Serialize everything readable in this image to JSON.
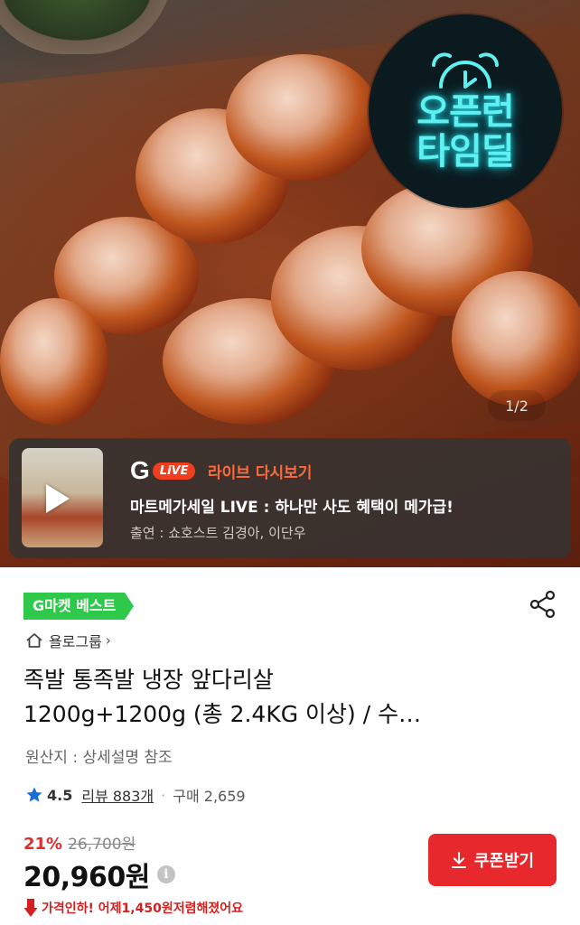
{
  "hero": {
    "badge_line1": "오픈런",
    "badge_line2": "타임딜",
    "image_counter": "1/2"
  },
  "live": {
    "logo_g": "G",
    "logo_live": "LiVE",
    "replay_label": "라이브 다시보기",
    "title": "마트메가세일 LIVE : 하나만 사도 혜택이 메가급!",
    "cast": "출연 : 쇼호스트 김경아, 이단우"
  },
  "product": {
    "best_tag": "G마켓 베스트",
    "store_name": "욜로그룹",
    "store_chevron": "›",
    "title_line1": "족발 통족발 냉장 앞다리살",
    "title_line2": "1200g+1200g (총 2.4KG 이상) / 수…",
    "origin": "원산지 : 상세설명 참조",
    "rating": "4.5",
    "review": "리뷰 883개",
    "dot": "·",
    "purchases": "구매 2,659",
    "discount": "21%",
    "original_price": "26,700원",
    "price": "20,960원",
    "info_icon": "i",
    "coupon_label": "쿠폰받기",
    "price_drop_lead": "가격인하! 어제 ",
    "price_drop_amount": "1,450원",
    "price_drop_tail": " 저렴해졌어요"
  },
  "colors": {
    "accent_red": "#e7282c",
    "best_green": "#2ec84a",
    "neon_cyan": "#5ff0f0",
    "live_orange": "#ff6a3d",
    "star_blue": "#1a6ed8"
  },
  "icons": {
    "share": "share-icon",
    "home": "home-icon",
    "star": "star-icon",
    "coupon": "download-icon",
    "drop": "down-arrow-icon",
    "play": "play-icon",
    "clock": "alarm-clock-icon"
  }
}
